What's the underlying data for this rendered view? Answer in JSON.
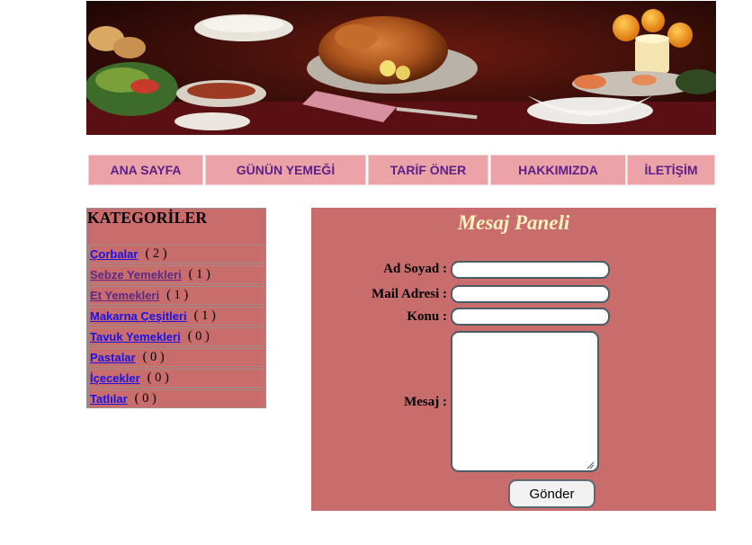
{
  "banner": {
    "icon": "food-banner-image"
  },
  "nav": {
    "items": [
      {
        "label": "ANA SAYFA"
      },
      {
        "label": "GÜNÜN YEMEĞİ"
      },
      {
        "label": "TARİF ÖNER"
      },
      {
        "label": "HAKKIMIZDA"
      },
      {
        "label": "İLETİŞİM"
      }
    ],
    "background": "#eca3a8",
    "text_color": "#5b1f86"
  },
  "categories": {
    "title": "KATEGORİLER",
    "items": [
      {
        "label": "Çorbalar",
        "count": "( 2 )",
        "visited": false
      },
      {
        "label": "Sebze Yemekleri",
        "count": "( 1 )",
        "visited": true
      },
      {
        "label": "Et Yemekleri",
        "count": "( 1 )",
        "visited": true
      },
      {
        "label": "Makarna Çeşitleri",
        "count": "( 1 )",
        "visited": false
      },
      {
        "label": "Tavuk Yemekleri",
        "count": "( 0 )",
        "visited": false
      },
      {
        "label": "Pastalar",
        "count": "( 0 )",
        "visited": false
      },
      {
        "label": "İçecekler",
        "count": "( 0 )",
        "visited": false
      },
      {
        "label": "Tatlılar",
        "count": "( 0 )",
        "visited": false
      }
    ],
    "background": "#c96c6c"
  },
  "panel": {
    "title": "Mesaj Paneli",
    "fields": {
      "name_label": "Ad Soyad :",
      "name_value": "",
      "email_label": "Mail Adresi :",
      "email_value": "",
      "subject_label": "Konu :",
      "subject_value": "",
      "message_label": "Mesaj :",
      "message_value": ""
    },
    "send_label": "Gönder",
    "background": "#c96c6c",
    "title_color": "#fff3c0"
  }
}
